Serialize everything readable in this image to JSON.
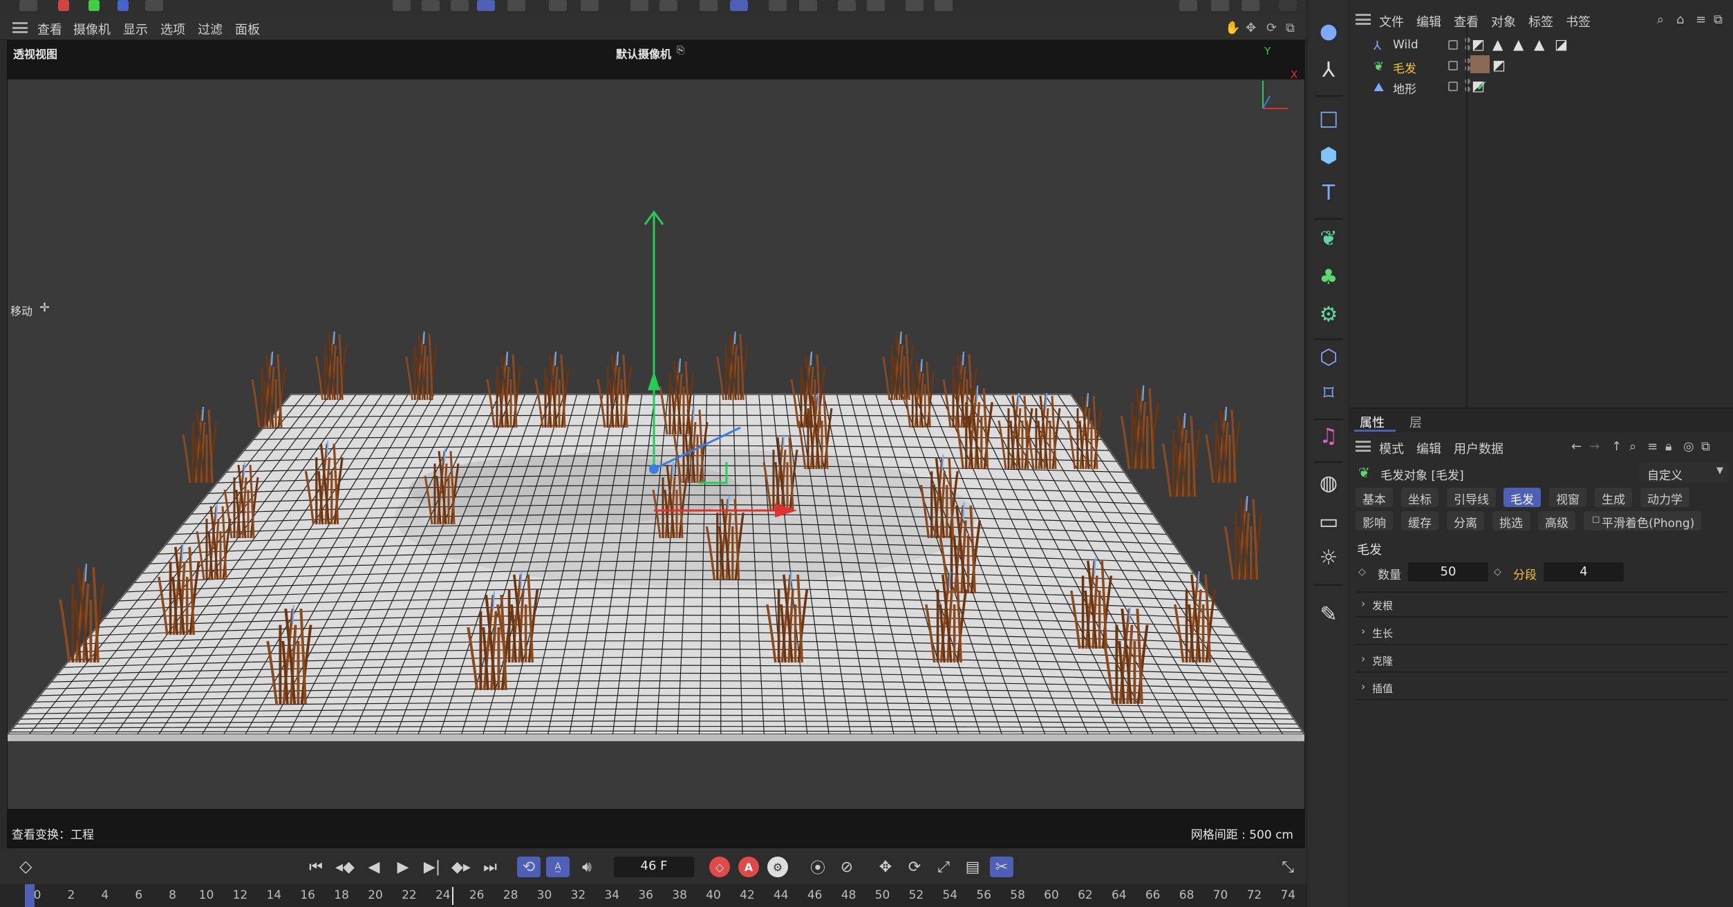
{
  "viewport_menu": {
    "items": [
      "查看",
      "摄像机",
      "显示",
      "选项",
      "过滤",
      "面板"
    ]
  },
  "viewport": {
    "view_name": "透视视图",
    "camera_label": "默认摄像机",
    "tool_label": "移动",
    "footer_left": "查看变换：工程",
    "footer_right": "网格间距 : 500 cm",
    "axis_y": "Y",
    "axis_x": "X"
  },
  "object_manager": {
    "menu": [
      "文件",
      "编辑",
      "查看",
      "对象",
      "标签",
      "书签"
    ],
    "objects": [
      {
        "name": "Wild",
        "color": "#d8d8d8",
        "icon": "wild-icon",
        "checked": false
      },
      {
        "name": "毛发",
        "color": "#f2c23a",
        "icon": "hair-icon",
        "checked": true
      },
      {
        "name": "地形",
        "color": "#d8d8d8",
        "icon": "landscape-icon",
        "checked": true
      }
    ]
  },
  "attributes": {
    "tabs": [
      "属性",
      "层"
    ],
    "menu": [
      "模式",
      "编辑",
      "用户数据"
    ],
    "object_title": "毛发对象 [毛发]",
    "preset": "自定义",
    "tab_row1": [
      "基本",
      "坐标",
      "引导线",
      "毛发",
      "视窗",
      "生成",
      "动力学"
    ],
    "tab_row2": [
      "影响",
      "缓存",
      "分离",
      "挑选",
      "高级",
      "平滑着色(Phong)"
    ],
    "active_tab": "毛发",
    "section_title": "毛发",
    "count_label": "数量",
    "count_value": "50",
    "segments_label": "分段",
    "segments_value": "4",
    "collapsed_sections": [
      "发根",
      "生长",
      "克隆",
      "插值"
    ]
  },
  "playback": {
    "current_frame": "46 F",
    "record_label": "A"
  },
  "timeline": {
    "ticks": [
      "0",
      "2",
      "4",
      "6",
      "8",
      "10",
      "12",
      "14",
      "16",
      "18",
      "20",
      "22",
      "24",
      "26",
      "28",
      "30",
      "32",
      "34",
      "36",
      "38",
      "40",
      "42",
      "44",
      "46",
      "48",
      "50",
      "52",
      "54",
      "56",
      "58",
      "60",
      "62",
      "64",
      "66",
      "68",
      "70",
      "72",
      "74"
    ]
  },
  "colors": {
    "accent": "#4d60b6",
    "hair_brown": "#8a4a1e",
    "grid_line": "#1e1e1e",
    "plane": "#d9d9d9",
    "y_axis": "#22cc55",
    "x_axis": "#e03030",
    "z_axis": "#3a7de0"
  }
}
